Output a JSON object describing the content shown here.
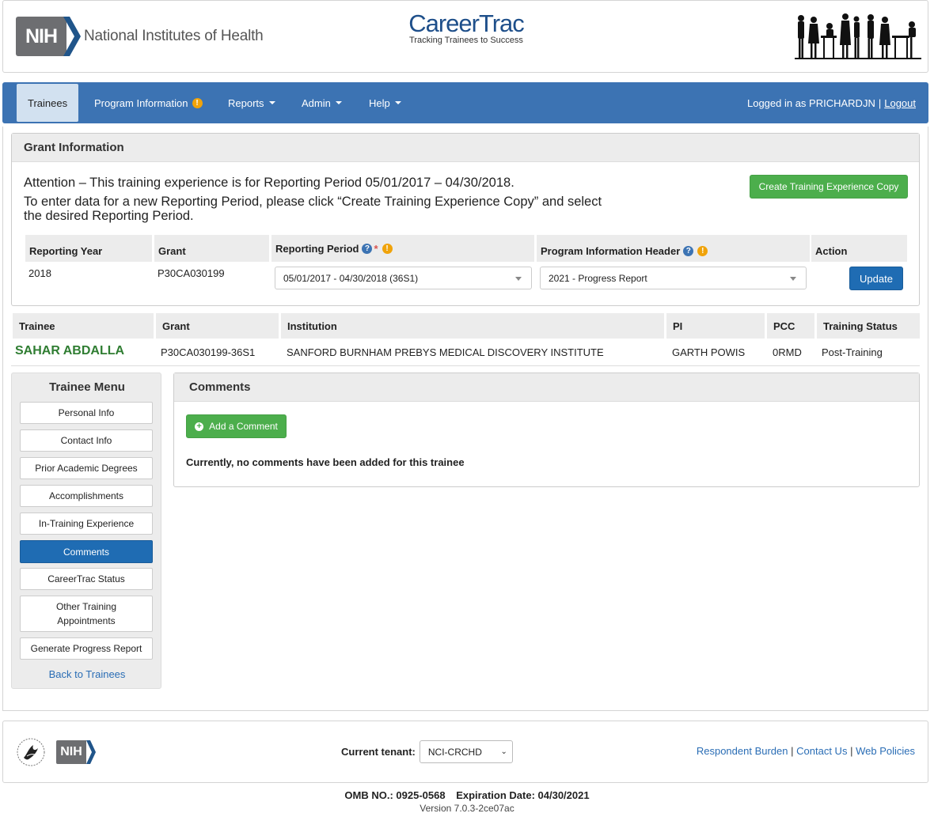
{
  "header": {
    "nih_badge": "NIH",
    "nih_name": "National Institutes of Health",
    "app_title": "CareerTrac",
    "app_tagline": "Tracking Trainees to Success"
  },
  "nav": {
    "trainees": "Trainees",
    "program_information": "Program Information",
    "warn_glyph": "!",
    "reports": "Reports",
    "admin": "Admin",
    "help": "Help",
    "logged_in": "Logged in as PRICHARDJN",
    "separator": "|",
    "logout": "Logout"
  },
  "grant": {
    "panel_title": "Grant Information",
    "attention_line1": "Attention – This training experience is for Reporting Period 05/01/2017 – 04/30/2018.",
    "attention_line2": "To enter data for a new Reporting Period, please click “Create Training Experience Copy” and select the desired Reporting Period.",
    "create_copy_button": "Create Training Experience Copy",
    "columns": {
      "reporting_year": "Reporting Year",
      "grant": "Grant",
      "reporting_period": "Reporting Period",
      "required_mark": "*",
      "help_glyph": "?",
      "program_info_header": "Program Information Header",
      "action": "Action"
    },
    "row": {
      "reporting_year": "2018",
      "grant": "P30CA030199",
      "reporting_period": "05/01/2017 - 04/30/2018 (36S1)",
      "program_info_header": "2021 - Progress Report",
      "update_button": "Update"
    }
  },
  "trainee": {
    "columns": [
      "Trainee",
      "Grant",
      "Institution",
      "PI",
      "PCC",
      "Training Status"
    ],
    "row": {
      "name": "SAHAR ABDALLA",
      "grant": "P30CA030199-36S1",
      "institution": "SANFORD BURNHAM PREBYS MEDICAL DISCOVERY INSTITUTE",
      "pi": "GARTH POWIS",
      "pcc": "0RMD",
      "status": "Post-Training"
    }
  },
  "menu": {
    "title": "Trainee Menu",
    "items": [
      "Personal Info",
      "Contact Info",
      "Prior Academic Degrees",
      "Accomplishments",
      "In-Training Experience",
      "Comments",
      "CareerTrac Status",
      "Other Training Appointments",
      "Generate Progress Report"
    ],
    "active_item": "Comments",
    "back_link": "Back to Trainees"
  },
  "comments": {
    "title": "Comments",
    "add_button": "Add a Comment",
    "plus_glyph": "+",
    "empty_message": "Currently, no comments have been added for this trainee"
  },
  "footer": {
    "nih_badge": "NIH",
    "tenant_label": "Current tenant:",
    "tenant_value": "NCI-CRCHD",
    "chevron_glyph": "⌄",
    "links": [
      "Respondent Burden",
      "Contact Us",
      "Web Policies"
    ],
    "link_separator": "|",
    "omb_no": "OMB NO.: 0925-0568",
    "expiration": "Expiration Date: 04/30/2021",
    "version": "Version 7.0.3-2ce07ac"
  },
  "colors": {
    "navbar": "#3c73b3",
    "primary_button": "#1f6cb3",
    "success_button": "#4cae4c",
    "trainee_name": "#2f7d32",
    "warning": "#f0a30a"
  }
}
